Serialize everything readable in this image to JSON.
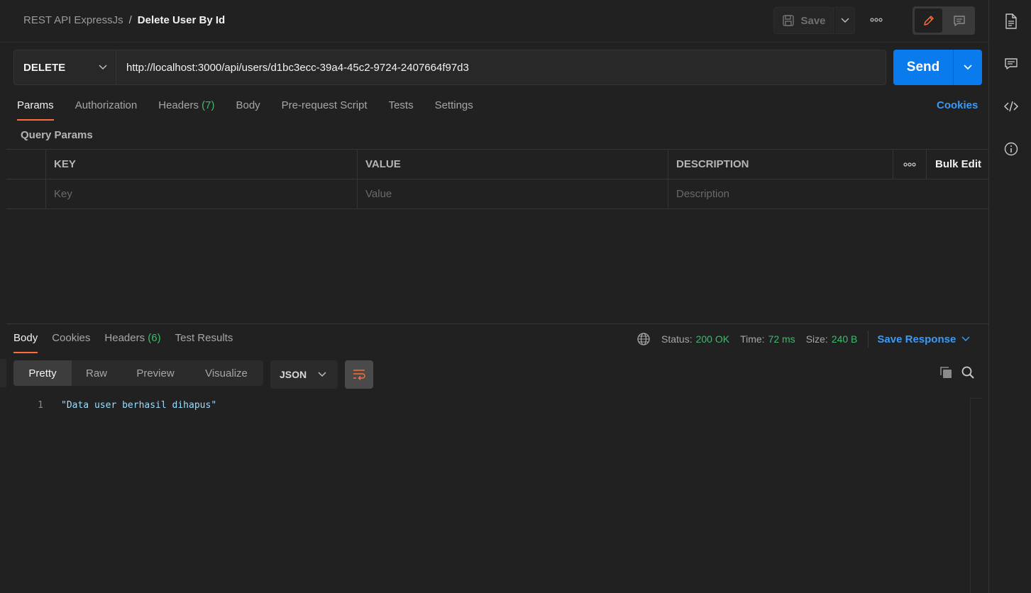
{
  "header": {
    "collection": "REST API ExpressJs",
    "separator": "/",
    "request_name": "Delete User By Id",
    "save_label": "Save"
  },
  "request": {
    "method": "DELETE",
    "url": "http://localhost:3000/api/users/d1bc3ecc-39a4-45c2-9724-2407664f97d3",
    "send_label": "Send"
  },
  "request_tabs": [
    {
      "label": "Params",
      "count": ""
    },
    {
      "label": "Authorization",
      "count": ""
    },
    {
      "label": "Headers",
      "count": "(7)"
    },
    {
      "label": "Body",
      "count": ""
    },
    {
      "label": "Pre-request Script",
      "count": ""
    },
    {
      "label": "Tests",
      "count": ""
    },
    {
      "label": "Settings",
      "count": ""
    }
  ],
  "cookies_link": "Cookies",
  "query_params": {
    "title": "Query Params",
    "columns": {
      "key": "KEY",
      "value": "VALUE",
      "description": "DESCRIPTION"
    },
    "bulk_edit": "Bulk Edit",
    "placeholders": {
      "key": "Key",
      "value": "Value",
      "description": "Description"
    }
  },
  "response": {
    "tabs": [
      {
        "label": "Body",
        "count": ""
      },
      {
        "label": "Cookies",
        "count": ""
      },
      {
        "label": "Headers",
        "count": "(6)"
      },
      {
        "label": "Test Results",
        "count": ""
      }
    ],
    "status_label": "Status:",
    "status_value": "200 OK",
    "time_label": "Time:",
    "time_value": "72 ms",
    "size_label": "Size:",
    "size_value": "240 B",
    "save_response": "Save Response",
    "views": [
      "Pretty",
      "Raw",
      "Preview",
      "Visualize"
    ],
    "format": "JSON",
    "lines": [
      {
        "number": "1",
        "text": "\"Data user berhasil dihapus\""
      }
    ]
  },
  "colors": {
    "accent": "#ff6c37",
    "send": "#097bed",
    "link": "#3b9af5",
    "success": "#43b96e"
  }
}
